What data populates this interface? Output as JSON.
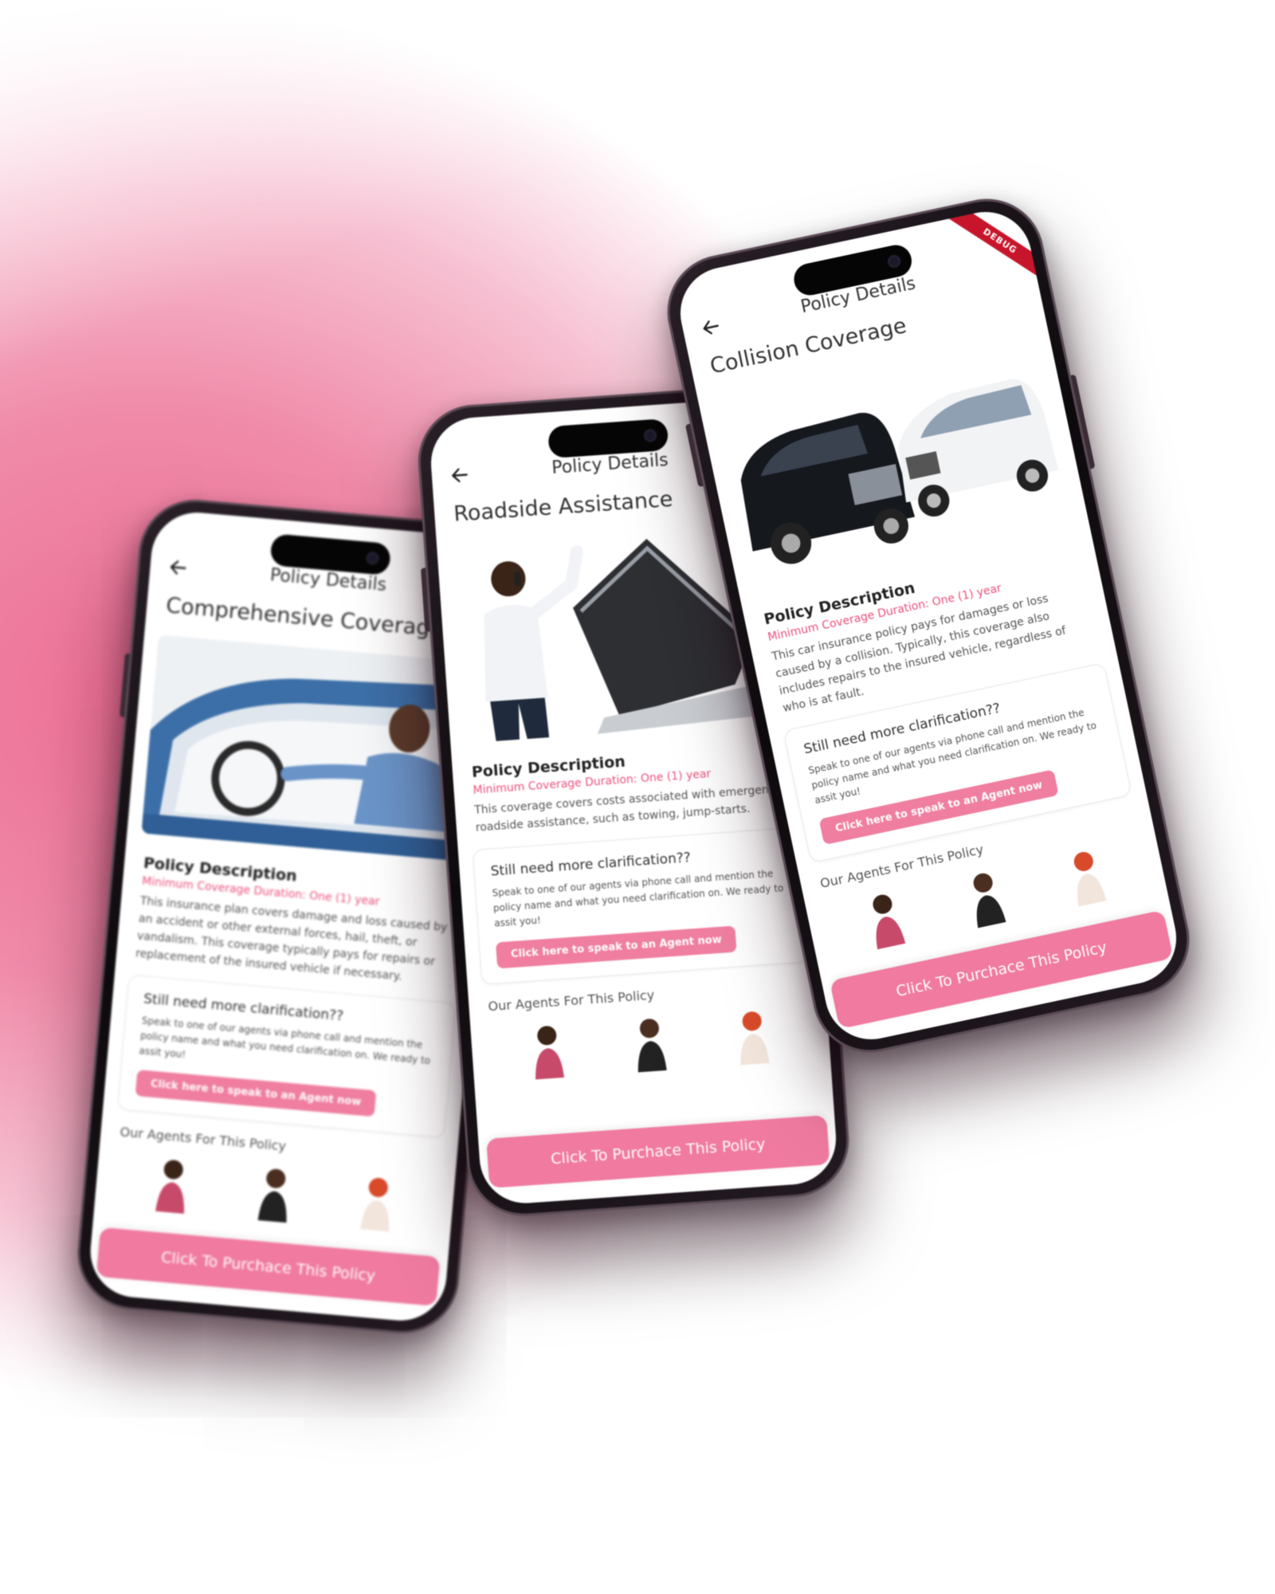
{
  "app_title": "Policy Details",
  "phones": [
    {
      "policy_name": "Comprehensive Coverage",
      "description_title": "Policy Description",
      "duration": "Minimum Coverage Duration: One (1) year",
      "description": "This insurance plan covers damage and loss caused by an accident or other external forces, hail, theft, or vandalism. This coverage typically pays for repairs or replacement of the insured vehicle if necessary."
    },
    {
      "policy_name": "Roadside Assistance",
      "description_title": "Policy Description",
      "duration": "Minimum Coverage Duration: One (1) year",
      "description": "This coverage covers costs associated with emergency roadside assistance, such as towing, jump-starts."
    },
    {
      "policy_name": "Collision Coverage",
      "description_title": "Policy Description",
      "duration": "Minimum Coverage Duration: One (1) year",
      "description": "This car insurance policy pays for damages or loss caused by a collision. Typically, this coverage also includes repairs to the insured vehicle, regardless of who is at fault."
    }
  ],
  "clarification": {
    "title": "Still need more clarification??",
    "text": "Speak to one of our agents via phone call and mention the policy name and what you need clarification on. We ready to assit you!",
    "button": "Click here to speak to an Agent now"
  },
  "agents_title": "Our Agents For This Policy",
  "purchase_button": "Click To Purchace This Policy",
  "debug_label": "DEBUG",
  "colors": {
    "accent": "#f07aa0",
    "duration": "#ea4f7c",
    "background": "#ec6f95"
  }
}
